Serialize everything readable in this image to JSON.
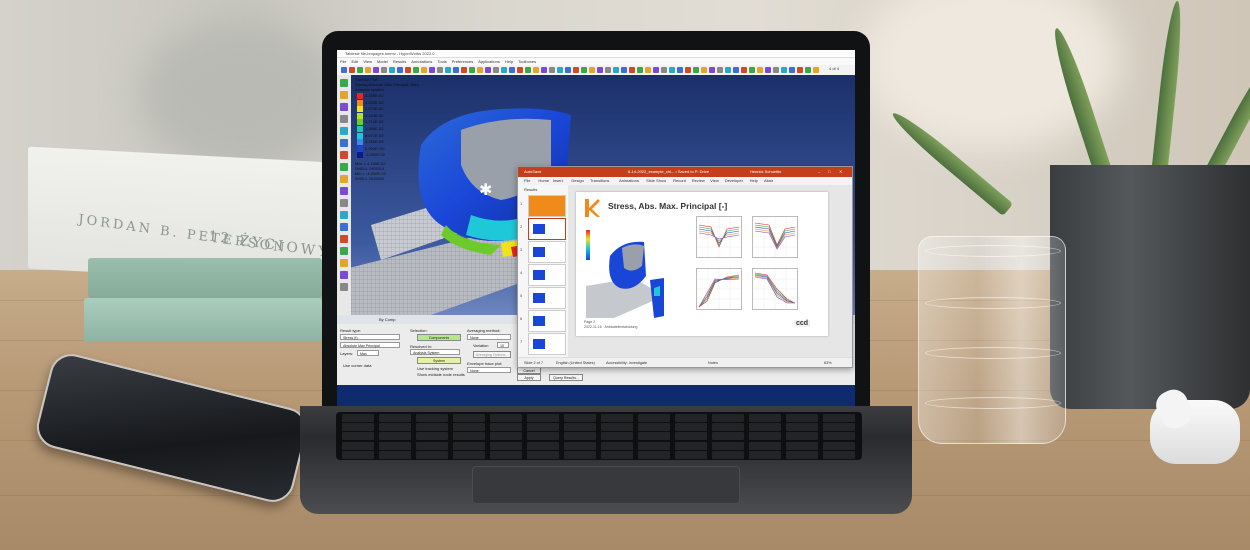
{
  "book": {
    "author": "JORDAN B. PETERSON",
    "title": "12 ŻYCIOWYCH ZASAD"
  },
  "hyperview": {
    "window_title": "Tablesie file-hmpages.hmmv - HyperWorks 2022.0",
    "menu": [
      "File",
      "Edit",
      "View",
      "Model",
      "Results",
      "Annotations",
      "Tools",
      "Preferences",
      "Applications",
      "Help",
      "Toolboxes"
    ],
    "page_counter": "4 of 4",
    "legend": {
      "title": "Contour Plot",
      "subtitle": "Stress(Absolute Max Principal, Max)",
      "system": "Analysis system",
      "values": [
        "4.156E-02",
        "3.000E-02",
        "2.571E-02",
        "2.143E-02",
        "1.714E-02",
        "1.286E-02",
        "8.571E-03",
        "4.286E-03",
        "0.000E+00",
        "-4.200E-02"
      ],
      "max": "Max = 4.156E-02",
      "max_elem": "SHELL 2409014",
      "min": "Min = -4.200E-02",
      "min_elem": "SHELL 2019832"
    },
    "colors": {
      "red": "#e8261c",
      "orange": "#f08a1a",
      "yellow": "#f2e21a",
      "green": "#6ccb2a",
      "cyan": "#1ec8d8",
      "blue": "#1a46d8",
      "darkblue": "#0a1a8a"
    },
    "panel": {
      "result_type_label": "Result type:",
      "result_type_value": "Stress (t)",
      "result_sub_value": "Absolute Max Principal",
      "layers_label": "Layers:",
      "layers_value": "Max",
      "use_corner": "Use corner data",
      "selection_label": "Selection:",
      "components_button": "Components",
      "resolved_label": "Resolved in:",
      "resolved_value": "Analysis System",
      "system_button": "System",
      "use_tracking": "Use tracking system",
      "show_midside": "Show midside node results",
      "averaging_label": "Averaging method:",
      "averaging_value": "None",
      "variation_label": "Variation",
      "variation_value": "10",
      "averaging_options": "Averaging Options...",
      "envelope_label": "Envelope trace plot:",
      "envelope_value": "None",
      "cancel": "Cancel",
      "apply": "Apply",
      "query": "Query Results...",
      "by_comp": "By Comp"
    }
  },
  "powerpoint": {
    "autosave": "AutoSave",
    "file_title": "6-14-2022_example_chi... • Saved to P: Drive",
    "user": "Henrick Schoettle",
    "tabs": [
      "File",
      "Home",
      "Insert",
      "Design",
      "Transitions",
      "Animations",
      "Slide Show",
      "Record",
      "Review",
      "View",
      "Developer",
      "Help",
      "Altair"
    ],
    "section": "Results",
    "slide_numbers": [
      "1",
      "2",
      "3",
      "4",
      "5",
      "6",
      "7"
    ],
    "slide_title": "Stress, Abs. Max. Principal [-]",
    "slide_footer": "Page 2",
    "slide_footer2": "2022-11-16 · Anbauteilentwicklung",
    "brand": "ccd",
    "status_slide": "Slide 2 of 7",
    "status_lang": "English (United States)",
    "status_access": "Accessibility: Investigate",
    "status_notes": "Notes",
    "status_zoom": "63%"
  }
}
